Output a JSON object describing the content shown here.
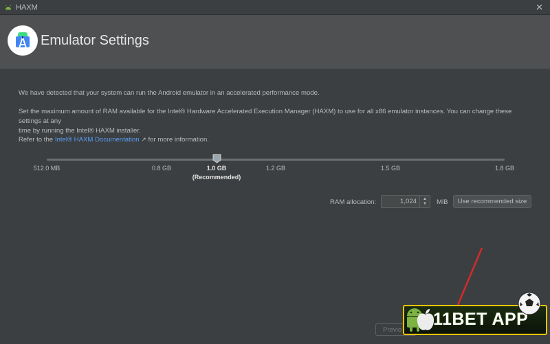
{
  "window": {
    "title": "HAXM",
    "close_glyph": "✕"
  },
  "header": {
    "title": "Emulator Settings",
    "logo_icon": "android-studio-logo-icon"
  },
  "body": {
    "detected_text": "We have detected that your system can run the Android emulator in an accelerated performance mode.",
    "ram_text_line1": "Set the maximum amount of RAM available for the Intel® Hardware Accelerated Execution Manager (HAXM) to use for all x86 emulator instances. You can change these settings at any",
    "ram_text_line2": "time by running the Intel® HAXM installer.",
    "refer_prefix": "Refer to the",
    "doc_link": "Intel® HAXM Documentation",
    "ext_glyph": "↗",
    "refer_suffix": "for more information."
  },
  "slider": {
    "ticks": [
      "512.0 MB",
      "0.8 GB",
      "1.0 GB",
      "1.2 GB",
      "1.5 GB",
      "1.8 GB"
    ],
    "selected_sub": "(Recommended)",
    "selected_index": 2
  },
  "ram": {
    "label": "RAM allocation:",
    "value": "1,024",
    "unit": "MiB",
    "recommend_button": "Use recommended size"
  },
  "footer": {
    "previous_button": "Previo"
  },
  "overlay": {
    "banner_text": "11BET APP",
    "accent": "#f0c400"
  },
  "colors": {
    "background": "#3c3f41",
    "header": "#4e5052",
    "link": "#589df6",
    "annotation_arrow": "#d42a2a"
  }
}
